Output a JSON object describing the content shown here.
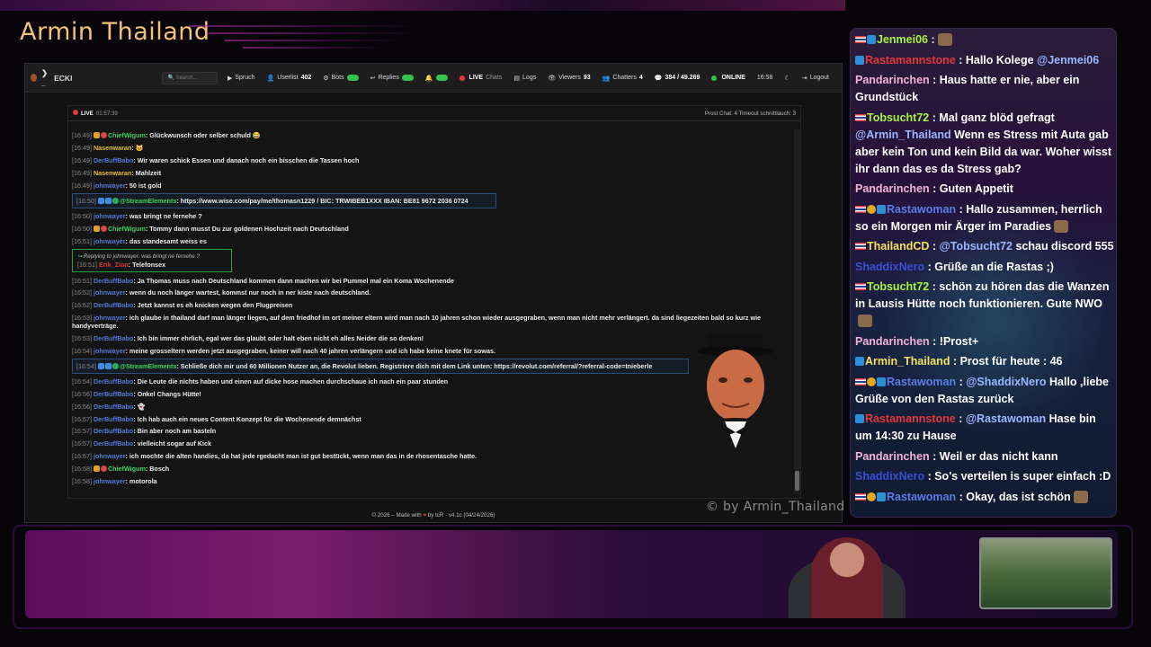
{
  "stream_title": "Armin Thailand",
  "watermark": "© by Armin_Thailand",
  "app": {
    "brand": "ECKI",
    "search_placeholder": "Search...",
    "nav": {
      "spruch": "Spruch",
      "userlist": "Userlist",
      "userlist_count": "402",
      "bots": "Bots",
      "replies": "Replies",
      "live": "LIVE",
      "chats": "Chats",
      "logs": "Logs",
      "viewers": "Viewers",
      "viewers_count": "93",
      "chatters": "Chatters",
      "chatters_count": "4",
      "messages": "384 / 49.269",
      "online": "ONLINE",
      "clock": "16:58",
      "logout": "Logout"
    },
    "chat_head": {
      "live": "LIVE",
      "time": "01:57:39",
      "right": "Prost Chat: 4  Timeout schnittlauch: 3"
    },
    "messages": [
      {
        "ts": "[16:49]",
        "user": "ChiefWigum",
        "color": "green",
        "badges": [
          "gold",
          "red"
        ],
        "text": ": Glückwunsch oder selber schuld 😂"
      },
      {
        "ts": "[16:49]",
        "user": "Nasenwaran",
        "color": "gold",
        "text": ": 🐱"
      },
      {
        "ts": "[16:49]",
        "user": "DerBuffBabo",
        "color": "blue",
        "text": ": Wir waren schick Essen und danach noch ein bisschen die Tassen hoch"
      },
      {
        "ts": "[16:49]",
        "user": "Nasenwaran",
        "color": "gold",
        "text": ": Mahlzeit"
      },
      {
        "ts": "[16:49]",
        "user": "johnwayer",
        "color": "blue",
        "text": ": 50 ist gold"
      },
      {
        "ts": "[16:50]",
        "user": "@StreamElements",
        "color": "green",
        "se": true,
        "text": ": https://www.wise.com/pay/me/thomasn1229 / BIC: TRWIBEB1XXX IBAN: BE81 9672 2036 0724"
      },
      {
        "ts": "[16:50]",
        "user": "johnwayer",
        "color": "blue",
        "text": ": was bringt ne fernehe ?"
      },
      {
        "ts": "[16:50]",
        "user": "ChiefWigum",
        "color": "green",
        "badges": [
          "gold",
          "red"
        ],
        "text": ": Tommy dann musst Du zur goldenen Hochzeit nach Deutschland"
      },
      {
        "ts": "[16:51]",
        "user": "johnwayer",
        "color": "blue",
        "text": ": das standesamt weiss es"
      },
      {
        "reply": true,
        "reply_line": "Replying to johnwayer: was bringt ne fernehe ?",
        "ts": "[16:51]",
        "user": "Erik_Zion",
        "color": "red",
        "text": ": Telefonsex"
      },
      {
        "ts": "[16:51]",
        "user": "DerBuffBabo",
        "color": "blue",
        "text": ": Ja Thomas muss nach Deutschland kommen dann machen wir bei Pummel mal ein Koma Wochenende"
      },
      {
        "ts": "[16:52]",
        "user": "johnwayer",
        "color": "blue",
        "text": ": wenn du noch länger wartest, kommst nur noch in ner kiste nach deutschland."
      },
      {
        "ts": "[16:52]",
        "user": "DerBuffBabo",
        "color": "blue",
        "text": ": Jetzt kannst es eh knicken wegen den Flugpreisen"
      },
      {
        "ts": "[16:53]",
        "user": "johnwayer",
        "color": "blue",
        "text": ": ich glaube in thailand darf man länger liegen, auf dem friedhof im ort meiner eltern wird man nach 10 jahren schon wieder ausgegraben, wenn man nicht mehr verlängert. da sind liegezeiten bald so kurz wie handyverträge."
      },
      {
        "ts": "[16:53]",
        "user": "DerBuffBabo",
        "color": "blue",
        "text": ": Ich bin immer ehrlich, egal wer das glaubt oder halt eben nicht eh alles Neider die so denken!"
      },
      {
        "ts": "[16:54]",
        "user": "johnwayer",
        "color": "blue",
        "text": ": meine grosseltern werden jetzt ausgegraben, keiner will nach 40 jahren verlängern und ich habe keine knete für sowas."
      },
      {
        "ts": "[16:54]",
        "user": "@StreamElements",
        "color": "green",
        "se": true,
        "long": true,
        "text": ": Schließe dich mir und 60 Millionen Nutzer an, die Revolut lieben. Registriere dich mit dem Link unten: https://revolut.com/referral/?referral-code=tnieberle"
      },
      {
        "ts": "[16:54]",
        "user": "DerBuffBabo",
        "color": "blue",
        "text": ": Die Leute die nichts haben und einen auf dicke hose machen durchschaue ich nach ein paar stunden"
      },
      {
        "ts": "[16:56]",
        "user": "DerBuffBabo",
        "color": "blue",
        "text": ": Onkel Changs Hütte!"
      },
      {
        "ts": "[16:56]",
        "user": "DerBuffBabo",
        "color": "blue",
        "text": ": 👻"
      },
      {
        "ts": "[16:57]",
        "user": "DerBuffBabo",
        "color": "blue",
        "text": ": Ich hab auch ein neues Content Konzept für die Wochenende demnächst"
      },
      {
        "ts": "[16:57]",
        "user": "DerBuffBabo",
        "color": "blue",
        "text": ": Bin aber noch am basteln"
      },
      {
        "ts": "[16:57]",
        "user": "DerBuffBabo",
        "color": "blue",
        "text": ": vielleicht sogar auf Kick"
      },
      {
        "ts": "[16:57]",
        "user": "johnwayer",
        "color": "blue",
        "text": ": ich mochte die alten handies, da hat jede rgedacht man ist gut bestückt, wenn man das in de rhosentasche hatte."
      },
      {
        "ts": "[16:58]",
        "user": "ChiefWigum",
        "color": "green",
        "badges": [
          "gold",
          "red"
        ],
        "text": ": Bosch"
      },
      {
        "ts": "[16:58]",
        "user": "johnwayer",
        "color": "blue",
        "text": ": motorola"
      }
    ],
    "footer": {
      "pre": "© 2026 – Made with",
      "heart": "♥",
      "post": "by tcR · v4.1c (04/24/2026)"
    }
  },
  "overlay_chat": [
    {
      "user": "Jenmei06",
      "color": "green",
      "flag": true,
      "icon": "teal",
      "text": " :"
    },
    {
      "user": "Rastamannstone",
      "color": "red",
      "icon": "teal",
      "text": " : Hallo Kolege ",
      "mention": "@Jenmei06"
    },
    {
      "user": "Pandarinchen",
      "color": "pink",
      "text": " : Haus hatte er nie, aber ein Grundstück"
    },
    {
      "user": "Tobsucht72",
      "color": "green",
      "flag": true,
      "text": " : Mal ganz blöd gefragt ",
      "mention_first": "@Armin_Thailand",
      "text2": " Wenn es Stress mit Auta gab aber kein Ton und kein Bild da war. Woher wisst ihr dann das es da Stress gab?"
    },
    {
      "user": "Pandarinchen",
      "color": "pink",
      "text": " : Guten Appetit"
    },
    {
      "user": "Rastawoman",
      "color": "blue",
      "flag": true,
      "icon": "gold",
      "text": " : Hallo zusammen, herrlich so ein Morgen mir Ärger im Paradies"
    },
    {
      "user": "ThailandCD",
      "color": "yellow",
      "flag": true,
      "text": " : ",
      "mention": "@Tobsucht72",
      "text2": " schau discord 555"
    },
    {
      "user": "ShaddixNero",
      "color": "grey",
      "text": " : Grüße an die Rastas ;)"
    },
    {
      "user": "Tobsucht72",
      "color": "green",
      "flag": true,
      "text": " : schön zu hören das die Wanzen in Lausis Hütte noch funktionieren. Gute NWO"
    },
    {
      "user": "Pandarinchen",
      "color": "pink",
      "text": " : !Prost+"
    },
    {
      "user": "Armin_Thailand",
      "color": "yellow",
      "icon": "teal",
      "text": " : Prost für heute : 46"
    },
    {
      "user": "Rastawoman",
      "color": "blue",
      "flag": true,
      "icon": "gold",
      "text": " : ",
      "mention": "@ShaddixNero",
      "text2": " Hallo ,liebe Grüße von den Rastas zurück"
    },
    {
      "user": "Rastamannstone",
      "color": "red",
      "icon": "teal",
      "text": " : ",
      "mention": "@Rastawoman",
      "text2": " Hase bin um 14:30 zu Hause"
    },
    {
      "user": "Pandarinchen",
      "color": "pink",
      "text": " : Weil er das nicht kann"
    },
    {
      "user": "ShaddixNero",
      "color": "grey",
      "text": " : So's verteilen is super einfach :D"
    },
    {
      "user": "Rastawoman",
      "color": "blue",
      "flag": true,
      "icon": "gold",
      "text": " : Okay, das ist schön"
    }
  ]
}
